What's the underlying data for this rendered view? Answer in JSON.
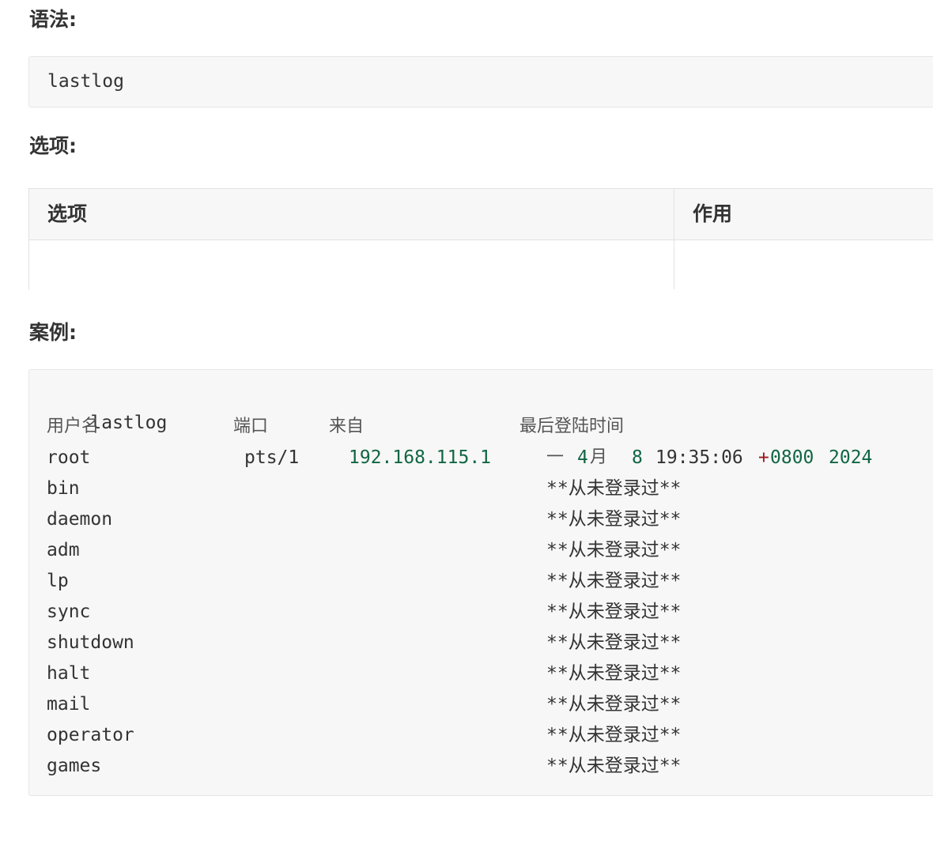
{
  "syntax": {
    "heading": "语法:",
    "code": "lastlog"
  },
  "options": {
    "heading": "选项:",
    "table": {
      "headers": [
        "选项",
        "作用"
      ],
      "rows": [
        [
          "",
          ""
        ]
      ]
    }
  },
  "example": {
    "heading": "案例:",
    "command": "lastlog",
    "header": {
      "username": "用户名",
      "port": "端口",
      "from": "来自",
      "last_login": "最后登陆时间"
    },
    "root_row": {
      "user": "root",
      "port": "pts/1",
      "from": "192.168.115.1",
      "weekday": "一",
      "month_num": "4",
      "month_unit": "月",
      "day": "8",
      "time": "19:35:06",
      "tz_sign": "+",
      "tz": "0800",
      "year": "2024"
    },
    "never_logged": "**从未登录过**",
    "users": [
      "bin",
      "daemon",
      "adm",
      "lp",
      "sync",
      "shutdown",
      "halt",
      "mail",
      "operator",
      "games"
    ]
  }
}
